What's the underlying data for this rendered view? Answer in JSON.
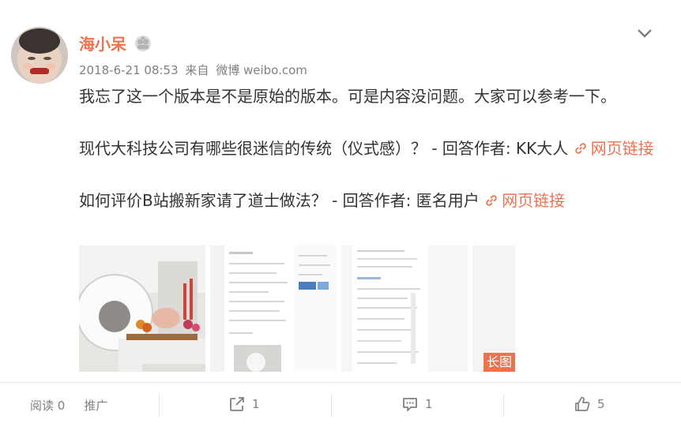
{
  "post": {
    "username": "海小呆",
    "timestamp": "2018-6-21 08:53",
    "via_prefix": "来自",
    "source": "微博 weibo.com",
    "text_line1": "我忘了这一个版本是不是原始的版本。可是内容没问题。大家可以参考一下。",
    "item1_text": "现代大科技公司有哪些很迷信的传统（仪式感）？ - 回答作者: KK大人 ",
    "item1_link": "网页链接",
    "item2_text": "如何评价B站搬新家请了道士做法？ - 回答作者: 匿名用户 ",
    "item2_link": "网页链接",
    "long_image_label": "长图"
  },
  "footer": {
    "read_label": "阅读 0",
    "promote_label": "推广",
    "repost_count": "1",
    "comment_count": "1",
    "like_count": "5"
  },
  "colors": {
    "accent": "#eb7350",
    "muted": "#808080"
  },
  "icons": {
    "vip": "vip-badge-icon",
    "more": "chevron-down-icon",
    "link": "link-chain-icon",
    "repost": "share-icon",
    "comment": "comment-icon",
    "like": "thumbs-up-icon"
  }
}
